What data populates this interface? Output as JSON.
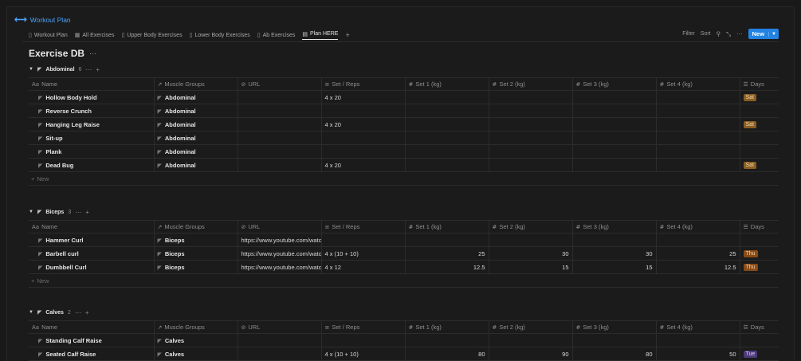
{
  "app": {
    "title": "Workout Plan",
    "icon": "dumbbell-icon"
  },
  "tabs": [
    {
      "label": "Workout Plan",
      "icon": "book-icon"
    },
    {
      "label": "All Exercises",
      "icon": "gallery-icon"
    },
    {
      "label": "Upper Body Exercises",
      "icon": "book-icon"
    },
    {
      "label": "Lower Body Exercises",
      "icon": "book-icon"
    },
    {
      "label": "Ab Exercises",
      "icon": "book-icon"
    },
    {
      "label": "Plan HERE",
      "icon": "table-icon",
      "active": true
    }
  ],
  "toolbar": {
    "filter": "Filter",
    "sort": "Sort",
    "new_label": "New"
  },
  "db_title": "Exercise DB",
  "columns": [
    "Name",
    "Muscle Groups",
    "URL",
    "Set / Reps",
    "Set 1 (kg)",
    "Set 2 (kg)",
    "Set 3 (kg)",
    "Set 4 (kg)",
    "Days"
  ],
  "new_row_label": "New",
  "groups": [
    {
      "name": "Abdominal",
      "count": "6",
      "rows": [
        {
          "name": "Hollow Body Hold",
          "muscle": "Abdominal",
          "url": "",
          "setreps": "4 x 20",
          "s1": "",
          "s2": "",
          "s3": "",
          "s4": "",
          "day": "Sat"
        },
        {
          "name": "Reverse Crunch",
          "muscle": "Abdominal",
          "url": "",
          "setreps": "",
          "s1": "",
          "s2": "",
          "s3": "",
          "s4": "",
          "day": ""
        },
        {
          "name": "Hanging Leg Raise",
          "muscle": "Abdominal",
          "url": "",
          "setreps": "4 x 20",
          "s1": "",
          "s2": "",
          "s3": "",
          "s4": "",
          "day": "Sat"
        },
        {
          "name": "Sit-up",
          "muscle": "Abdominal",
          "url": "",
          "setreps": "",
          "s1": "",
          "s2": "",
          "s3": "",
          "s4": "",
          "day": ""
        },
        {
          "name": "Plank",
          "muscle": "Abdominal",
          "url": "",
          "setreps": "",
          "s1": "",
          "s2": "",
          "s3": "",
          "s4": "",
          "day": ""
        },
        {
          "name": "Dead Bug",
          "muscle": "Abdominal",
          "url": "",
          "setreps": "4 x 20",
          "s1": "",
          "s2": "",
          "s3": "",
          "s4": "",
          "day": "Sat"
        }
      ]
    },
    {
      "name": "Biceps",
      "count": "3",
      "rows": [
        {
          "name": "Hammer Curl",
          "muscle": "Biceps",
          "url": "https://www.youtube.com/watch",
          "setreps": "",
          "s1": "",
          "s2": "",
          "s3": "",
          "s4": "",
          "day": ""
        },
        {
          "name": "Barbell curl",
          "muscle": "Biceps",
          "url": "https://www.youtube.com/watch",
          "setreps": "4 x (10 + 10)",
          "s1": "25",
          "s2": "30",
          "s3": "30",
          "s4": "25",
          "day": "Thu"
        },
        {
          "name": "Dumbbell Curl",
          "muscle": "Biceps",
          "url": "https://www.youtube.com/watch",
          "setreps": "4 x 12",
          "s1": "12.5",
          "s2": "15",
          "s3": "15",
          "s4": "12.5",
          "day": "Thu"
        }
      ]
    },
    {
      "name": "Calves",
      "count": "2",
      "rows": [
        {
          "name": "Standing Calf Raise",
          "muscle": "Calves",
          "url": "",
          "setreps": "",
          "s1": "",
          "s2": "",
          "s3": "",
          "s4": "",
          "day": ""
        },
        {
          "name": "Seated Calf Raise",
          "muscle": "Calves",
          "url": "",
          "setreps": "4 x (10 + 10)",
          "s1": "80",
          "s2": "90",
          "s3": "80",
          "s4": "50",
          "day": "Tue"
        }
      ]
    }
  ],
  "colors": {
    "accent": "#2383e2",
    "link": "#4aa3ff",
    "sat": "#8a5e22",
    "thu": "#8a4b16",
    "tue": "#4d3a7a"
  }
}
